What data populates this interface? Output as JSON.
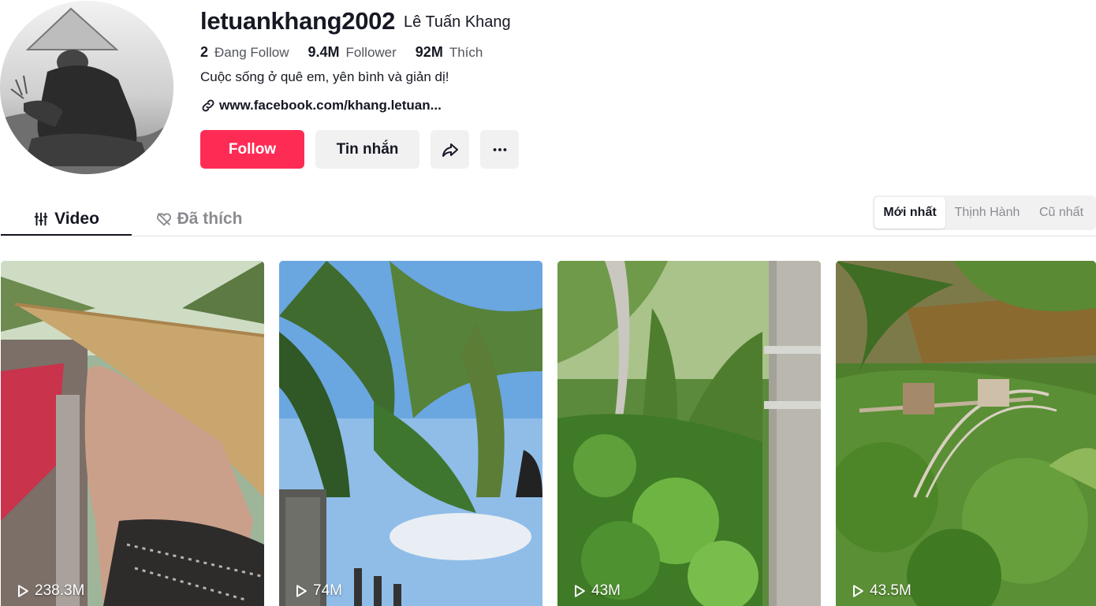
{
  "profile": {
    "username": "letuankhang2002",
    "nickname": "Lê Tuấn Khang",
    "stats": [
      {
        "count": "2",
        "label": "Đang Follow"
      },
      {
        "count": "9.4M",
        "label": "Follower"
      },
      {
        "count": "92M",
        "label": "Thích"
      }
    ],
    "bio": "Cuộc sống ở quê em, yên bình và giản dị!",
    "link": "www.facebook.com/khang.letuan..."
  },
  "actions": {
    "follow_label": "Follow",
    "message_label": "Tin nhắn",
    "share_icon": "share-icon",
    "more_icon": "more-dots-icon"
  },
  "colors": {
    "accent": "#fe2c55",
    "button_bg": "#f1f1f2",
    "text": "#161823",
    "muted": "#8a8b91"
  },
  "tabs": [
    {
      "label": "Video",
      "icon": "grid-icon",
      "active": true
    },
    {
      "label": "Đã thích",
      "icon": "liked-heart-icon",
      "active": false
    }
  ],
  "sort_options": [
    {
      "label": "Mới nhất",
      "active": true
    },
    {
      "label": "Thịnh Hành",
      "active": false
    },
    {
      "label": "Cũ nhất",
      "active": false
    }
  ],
  "videos": [
    {
      "views": "238.3M",
      "scene": "woman in conical hat"
    },
    {
      "views": "74M",
      "scene": "palm trees and blue sky"
    },
    {
      "views": "43M",
      "scene": "green garden with concrete pole"
    },
    {
      "views": "43.5M",
      "scene": "coconut grove with wooden structure"
    }
  ]
}
